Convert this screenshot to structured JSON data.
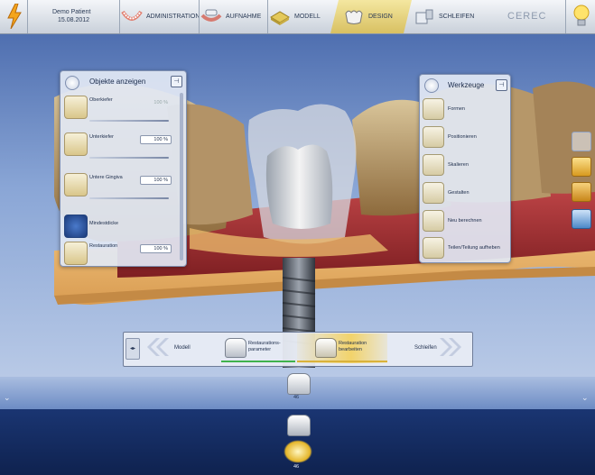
{
  "header": {
    "patient_name": "Demo Patient",
    "patient_date": "15.08.2012",
    "brand": "CEREC",
    "steps": [
      {
        "label": "ADMINISTRATION",
        "icon": "teeth-arch-icon"
      },
      {
        "label": "AUFNAHME",
        "icon": "camera-scan-icon"
      },
      {
        "label": "MODELL",
        "icon": "model-icon"
      },
      {
        "label": "DESIGN",
        "icon": "crown-design-icon",
        "active": true
      },
      {
        "label": "SCHLEIFEN",
        "icon": "milling-icon"
      }
    ]
  },
  "objects_panel": {
    "title": "Objekte anzeigen",
    "pin": "⊣",
    "items": [
      {
        "label": "Oberkiefer",
        "value": "100 %",
        "dim": true,
        "level": 1.0
      },
      {
        "label": "Unterkiefer",
        "value": "100 %",
        "dim": false,
        "level": 1.0
      },
      {
        "label": "Untere Gingiva",
        "value": "100 %",
        "dim": false,
        "level": 1.0
      },
      {
        "label": "Mindestdicke",
        "value": "",
        "dim": false
      },
      {
        "label": "Restauration",
        "value": "100 %",
        "dim": false
      }
    ]
  },
  "tools_panel": {
    "title": "Werkzeuge",
    "pin": "⊣",
    "items": [
      {
        "label": "Formen",
        "icon": "shape-icon"
      },
      {
        "label": "Positionieren",
        "icon": "position-icon"
      },
      {
        "label": "Skalieren",
        "icon": "scale-icon"
      },
      {
        "label": "Gestalten",
        "icon": "sculpt-icon"
      },
      {
        "label": "Neu berechnen",
        "icon": "recalculate-icon"
      },
      {
        "label": "Teilen/Teilung aufheben",
        "icon": "split-icon"
      }
    ]
  },
  "step_bar": {
    "toggle": "◂▸",
    "prev_label": "Modell",
    "step1_label_line1": "Restaurations-",
    "step1_label_line2": "parameter",
    "step2_label_line1": "Restauration",
    "step2_label_line2": "bearbeiten",
    "next_label": "Schleifen"
  },
  "tooth_number_1": "46",
  "tooth_number_2": "46",
  "colors": {
    "accent": "#f2d36b",
    "gum": "#b8363a",
    "model": "#e8b86d",
    "progress_green": "#3fb24d"
  }
}
